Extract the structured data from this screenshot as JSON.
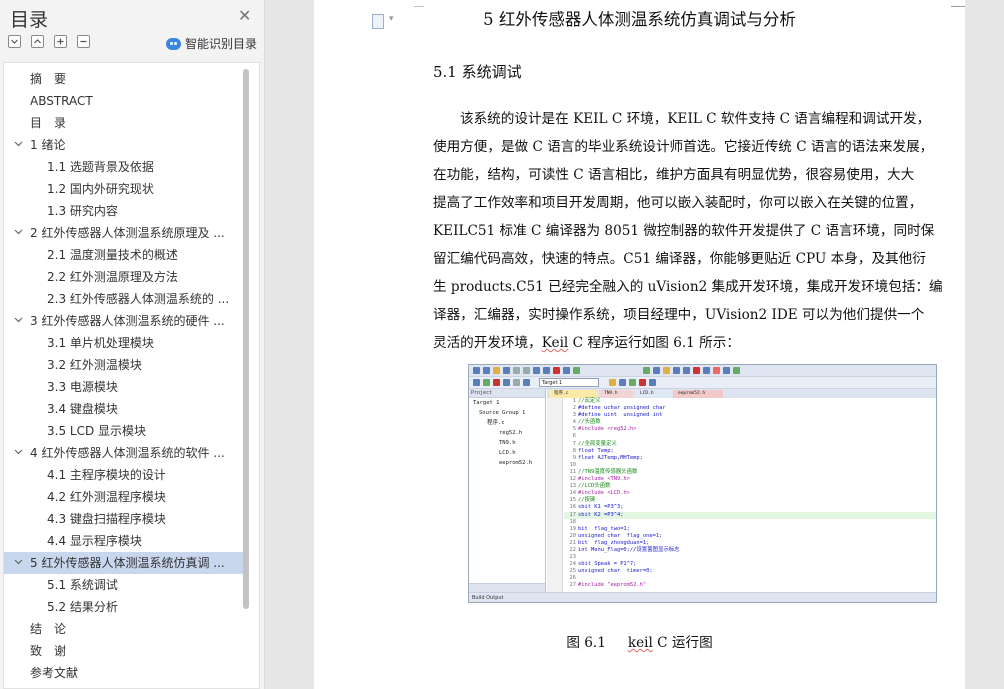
{
  "sidebar": {
    "title": "目录",
    "smart_toc": "智能识别目录",
    "toc": [
      {
        "label": "摘　要",
        "level": 1,
        "expandable": false
      },
      {
        "label": "ABSTRACT",
        "level": 1,
        "expandable": false
      },
      {
        "label": "目　录",
        "level": 1,
        "expandable": false
      },
      {
        "label": "1 绪论",
        "level": 1,
        "expandable": true
      },
      {
        "label": "1.1 选题背景及依据",
        "level": 2
      },
      {
        "label": "1.2 国内外研究现状",
        "level": 2
      },
      {
        "label": "1.3 研究内容",
        "level": 2
      },
      {
        "label": "2  红外传感器人体测温系统原理及 ...",
        "level": 1,
        "expandable": true
      },
      {
        "label": "2.1 温度测量技术的概述",
        "level": 2
      },
      {
        "label": "2.2  红外测温原理及方法",
        "level": 2
      },
      {
        "label": "2.3  红外传感器人体测温系统的 ...",
        "level": 2
      },
      {
        "label": "3  红外传感器人体测温系统的硬件 ...",
        "level": 1,
        "expandable": true
      },
      {
        "label": "3.1  单片机处理模块",
        "level": 2
      },
      {
        "label": "3.2  红外测温模块",
        "level": 2
      },
      {
        "label": "3.3  电源模块",
        "level": 2
      },
      {
        "label": "3.4  键盘模块",
        "level": 2
      },
      {
        "label": "3.5 LCD 显示模块",
        "level": 2
      },
      {
        "label": "4  红外传感器人体测温系统的软件 ...",
        "level": 1,
        "expandable": true
      },
      {
        "label": "4.1  主程序模块的设计",
        "level": 2
      },
      {
        "label": "4.2  红外测温程序模块",
        "level": 2
      },
      {
        "label": "4.3  键盘扫描程序模块",
        "level": 2
      },
      {
        "label": "4.4  显示程序模块",
        "level": 2
      },
      {
        "label": "5  红外传感器人体测温系统仿真调 ...",
        "level": 1,
        "expandable": true,
        "active": true
      },
      {
        "label": "5.1 系统调试",
        "level": 2
      },
      {
        "label": "5.2  结果分析",
        "level": 2
      },
      {
        "label": "结　论",
        "level": 1,
        "expandable": false
      },
      {
        "label": "致　谢",
        "level": 1,
        "expandable": false
      },
      {
        "label": "参考文献",
        "level": 1,
        "expandable": false
      }
    ]
  },
  "document": {
    "chapter_title": "5  红外传感器人体测温系统仿真调试与分析",
    "section_title": "5.1 系统调试",
    "paragraph_lines": [
      "该系统的设计是在 KEIL C 环境，KEIL C 软件支持 C 语言编程和调试开发，",
      "使用方便，是做 C 语言的毕业系统设计师首选。它接近传统 C 语言的语法来发展，",
      "在功能，结构，可读性 C 语言相比，维护方面具有明显优势，很容易使用，大大",
      "提高了工作效率和项目开发周期，他可以嵌入装配时，你可以嵌入在关键的位置，",
      "KEILC51 标准 C 编译器为 8051 微控制器的软件开发提供了 C 语言环境，同时保",
      "留汇编代码高效，快速的特点。C51 编译器，你能够更贴近 CPU 本身，及其他衍",
      "生 products.C51 已经完全融入的 uVision2 集成开发环境，集成开发环境包括：编",
      "译器，汇编器，实时操作系统，项目经理中，UVision2 IDE 可以为他们提供一个"
    ],
    "last_line_pre": "灵活的开发环境，",
    "last_line_keil": "Keil",
    "last_line_post": " C 程序运行如图 6.1 所示：",
    "figure_caption_num": "图 6.1",
    "figure_caption_keil": "keil",
    "figure_caption_text": " C 运行图"
  },
  "keil_screenshot": {
    "target": "Target 1",
    "project_header": "Project",
    "project_tree": [
      "Target 1",
      "Source Group 1",
      "程序.c",
      "reg52.h",
      "TN9.h",
      "LCD.h",
      "eeprom52.h"
    ],
    "editor_tabs": [
      "程序.c",
      "TN9.h",
      "LCD.h",
      "eeprom52.h"
    ],
    "status": "Build Output",
    "code_lines": [
      {
        "n": "1",
        "text": "//宏定义",
        "cls": "c-com"
      },
      {
        "n": "2",
        "text": "#define uchar unsigned char",
        "cls": "c-pp"
      },
      {
        "n": "3",
        "text": "#define uint  unsigned int",
        "cls": "c-pp"
      },
      {
        "n": "4",
        "text": "//头函数",
        "cls": "c-com"
      },
      {
        "n": "5",
        "text": "#include <reg52.h>",
        "cls": "c-str"
      },
      {
        "n": "6",
        "text": "",
        "cls": "c-tx"
      },
      {
        "n": "7",
        "text": "//全局变量定义",
        "cls": "c-com"
      },
      {
        "n": "8",
        "text": "float Temp;",
        "cls": "c-kw"
      },
      {
        "n": "9",
        "text": "float AJTemp,MHTemp;",
        "cls": "c-kw"
      },
      {
        "n": "10",
        "text": "",
        "cls": "c-tx"
      },
      {
        "n": "11",
        "text": "//TN9温度传感器头函数",
        "cls": "c-com"
      },
      {
        "n": "12",
        "text": "#include <TN9.h>",
        "cls": "c-str"
      },
      {
        "n": "13",
        "text": "//LCD头函数",
        "cls": "c-com"
      },
      {
        "n": "14",
        "text": "#include <LCD.h>",
        "cls": "c-str"
      },
      {
        "n": "15",
        "text": "//按键",
        "cls": "c-com"
      },
      {
        "n": "16",
        "text": "sbit K1 =P3^3;",
        "cls": "c-kw"
      },
      {
        "n": "17",
        "text": "sbit K2 =P3^4;",
        "cls": "c-kw",
        "hl": true
      },
      {
        "n": "18",
        "text": "",
        "cls": "c-tx"
      },
      {
        "n": "19",
        "text": "bit  flag_two=1;",
        "cls": "c-kw"
      },
      {
        "n": "20",
        "text": "unsigned char  flag_one=1;",
        "cls": "c-kw"
      },
      {
        "n": "21",
        "text": "bit  flag_zhongduan=1;",
        "cls": "c-kw"
      },
      {
        "n": "22",
        "text": "int Menu_Flag=0;//设置菌图显示标志",
        "cls": "c-kw"
      },
      {
        "n": "23",
        "text": "",
        "cls": "c-tx"
      },
      {
        "n": "24",
        "text": "sbit Speak = P1^7;",
        "cls": "c-kw"
      },
      {
        "n": "25",
        "text": "unsigned char  timer=0;",
        "cls": "c-kw"
      },
      {
        "n": "26",
        "text": "",
        "cls": "c-tx"
      },
      {
        "n": "27",
        "text": "#include \"eeprom52.h\"",
        "cls": "c-str"
      }
    ]
  },
  "colors": {
    "active_toc_bg": "#c8d6ee",
    "accent_blue": "#3b86e0",
    "code_comment": "#1a8a1a",
    "code_keyword": "#1a1ad0"
  },
  "icons": {
    "close": "close-icon",
    "collapse_all": "collapse-all-icon",
    "expand_all": "expand-all-icon",
    "zoom_in": "plus-icon",
    "zoom_out": "minus-icon",
    "smart": "ai-recognize-icon",
    "doc": "document-icon"
  }
}
